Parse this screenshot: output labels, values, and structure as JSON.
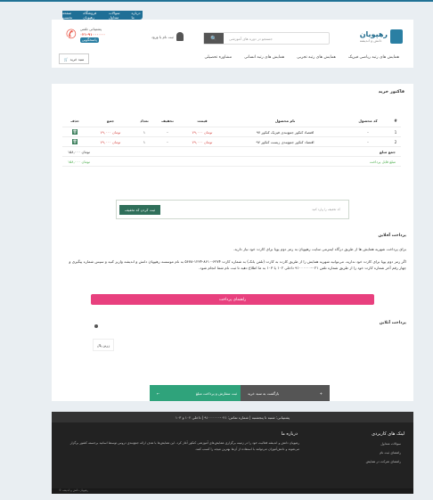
{
  "topbar": [
    "صفحه نخست",
    "فروشگاه رهپویان",
    "سوالات متداول",
    "درباره ما"
  ],
  "logo": {
    "title": "رهپویان",
    "subtitle": "دانش و اندیشه"
  },
  "search": {
    "placeholder": "جستجو در دوره های آموزشی"
  },
  "user": {
    "label": "ثبت نام یا ورود"
  },
  "phone": {
    "label": "پشتیبانی تلفنی",
    "number": "۰۲۱-۹۱۰۰۰۰۰۰",
    "badge": "پاسخگویی"
  },
  "cart": {
    "label": "سبد خرید"
  },
  "nav": [
    "همایش های رتبه ریاضی فیزیک",
    "همایش های رتبه تجربی",
    "همایش های رتبه انسانی",
    "مشاوره تحصیلی"
  ],
  "content": {
    "title": "فاکتور خرید"
  },
  "table": {
    "headers": [
      "کد محصول",
      "نام محصول",
      "قیمت",
      "تخفیف",
      "تعداد",
      "جمع",
      "حذف"
    ],
    "rows": [
      {
        "code": "-",
        "name": "اقتصاد کنکور جمع‌بندی فیزیک کنکور ۹۷",
        "price": "۷۹,۰۰۰ تومان",
        "discount": "-",
        "qty": "۱",
        "total": "۷۹,۰۰۰ تومان"
      },
      {
        "code": "-",
        "name": "اقتصاد کنکور جمع‌بندی زیست کنکور ۹۷",
        "price": "۷۹,۰۰۰ تومان",
        "discount": "-",
        "qty": "۱",
        "total": "۷۹,۰۰۰ تومان"
      }
    ],
    "sum_label": "جمع مبلغ",
    "sum_value": "۱۵۸,۰۰۰ تومان",
    "pay_label": "مبلغ قابل پرداخت",
    "pay_value": "۱۵۸,۰۰۰ تومان"
  },
  "discount": {
    "placeholder": "کد تخفیف را وارد کنید",
    "button": "ثبت کردن کد تخفیف"
  },
  "payment": {
    "title": "پرداخت آفلاین",
    "line1": "برای پرداخت شهریه همایش ها از طریق درگاه اینترنتی سایت رهپویان به رمز دوم پویا برای کارت خود نیاز دارید.",
    "line2": "اگر رمز دوم پویا برای کارت خود ندارید، می‌توانید شهریه همایش را از طریق کارت به کارت (تلفن بانک) به شماره کارت ۶۲۷۴-۸۶۱۰-۱۲۳۴-۵۶۷۸ به نام موسسه رهپویان دانش و اندیشه واریز کنید و سپس شماره پیگیری و چهار رقم آخر شماره کارت خود را از طریق شماره تلفن ۰۲۱-۹۱۰۰۰۰۰۰ داخلی ۱۰۲ یا ۱۰۳ به ما اطلاع دهید تا ثبت نام شما انجام شود.",
    "guide_button": "راهنمای پرداخت"
  },
  "online": {
    "title": "پرداخت آنلاین",
    "gateway": "زرین پال"
  },
  "buttons": {
    "back": "بازگشت به سبد خرید",
    "next": "ثبت سفارش و پرداخت مبلغ"
  },
  "footer": {
    "bar": "پشتیبانی: شنبه تا پنجشنبه | شماره تماس: ۰۲۱-۹۱۰۰۰۰۰۰ | داخلی ۱۰۲ و ۱۰۳",
    "links_title": "لینک های کاربردی",
    "links": [
      "سوالات متداول",
      "راهنمای ثبت نام",
      "راهنمای شرکت در همایش"
    ],
    "about_title": "درباره ما",
    "about": "رهپویان دانش و اندیشه فعالیت خود را در زمینه برگزاری همایش‌های آموزشی کنکور آغاز کرد. این همایش‌ها با هدف ارائه جمع‌بندی دروس توسط اساتید برجسته کشور برگزار می‌شوند و دانش‌آموزان می‌توانند با استفاده از آن‌ها بهترین نتیجه را کسب کنند.",
    "copyright": "© رهپویان دانش و اندیشه"
  }
}
